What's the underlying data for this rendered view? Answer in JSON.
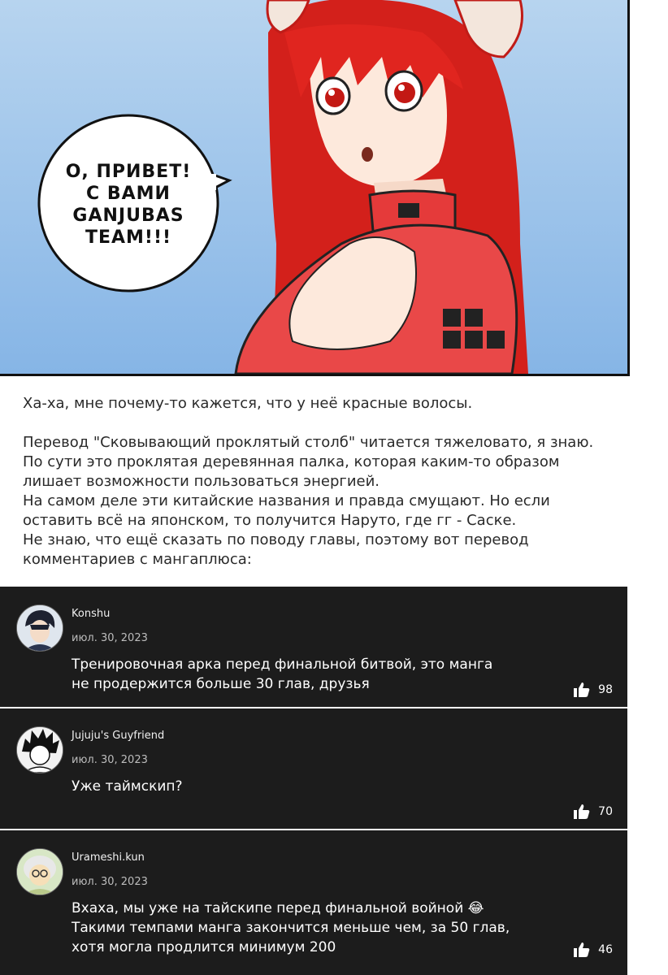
{
  "panel": {
    "bubble_text": "О, ПРИВЕТ!\nС ВАМИ\nGANJUBAS\nTEAM!!!"
  },
  "notes": {
    "line1": "Ха-ха, мне почему-то кажется, что у неё красные волосы.",
    "line2": "Перевод \"Сковывающий проклятый столб\" читается тяжеловато, я знаю.",
    "line3": "По сути это проклятая деревянная палка, которая каким-то образом",
    "line4": "лишает возможности пользоваться энергией.",
    "line5": "На самом деле эти китайские названия и правда смущают. Но если",
    "line6": "оставить всё на японском, то получится Наруто, где гг - Саске.",
    "line7": "Не знаю, что ещё сказать по поводу главы, поэтому вот перевод",
    "line8": "комментариев с мангаплюса:"
  },
  "comments": [
    {
      "user": "Konshu",
      "date": "июл. 30, 2023",
      "text": "Тренировочная арка перед финальной битвой, это манга\nне продержится больше 30 глав, друзья",
      "likes": "98",
      "avatar_icon": "dark-haired-character-avatar"
    },
    {
      "user": "Jujuju's Guyfriend",
      "date": "июл. 30, 2023",
      "text": "Уже таймскип?",
      "likes": "70",
      "avatar_icon": "spiky-hair-character-avatar"
    },
    {
      "user": "Urameshi.kun",
      "date": "июл. 30, 2023",
      "text": "Вхаха, мы уже на тайскипе перед финальной войной 😂\nТакими темпами манга закончится меньше чем, за 50 глав,\nхотя могла продлится минимум 200",
      "likes": "46",
      "avatar_icon": "old-man-character-avatar"
    }
  ],
  "colors": {
    "comment_bg": "#1c1c1c",
    "hair": "#e0251f",
    "sky": "#9cc3ea"
  }
}
